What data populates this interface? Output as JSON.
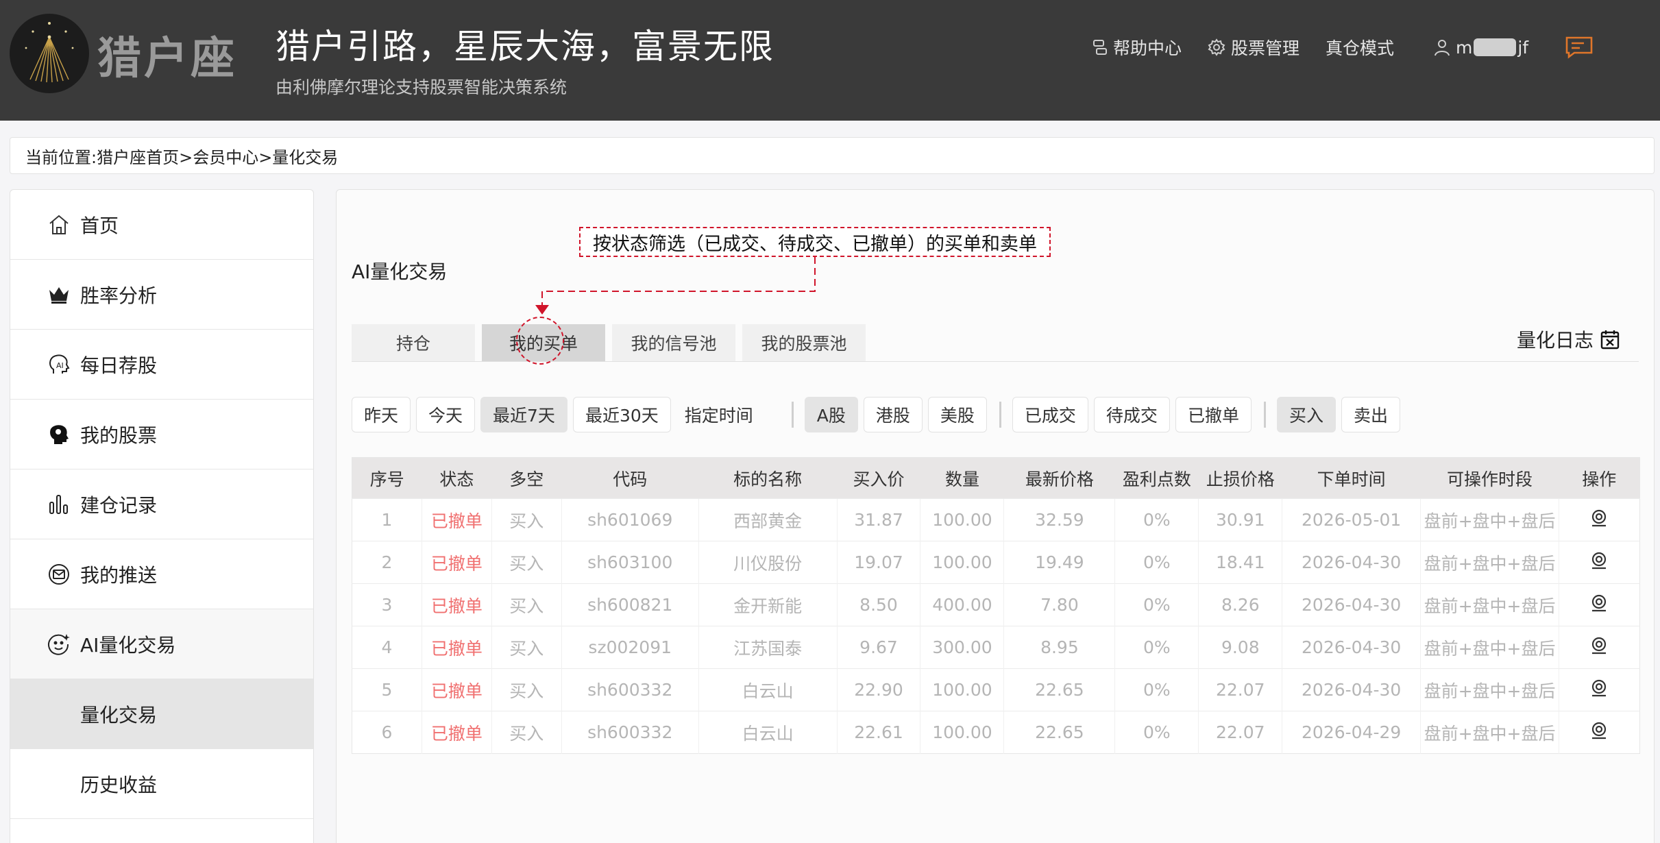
{
  "header": {
    "logo_text": "猎户座",
    "slogan": "猎户引路，星辰大海，富景无限",
    "subslogan": "由利佛摩尔理论支持股票智能决策系统",
    "nav": {
      "help": "帮助中心",
      "stock_mgmt": "股票管理",
      "real_mode": "真仓模式",
      "user_prefix": "m",
      "user_suffix": "jf"
    }
  },
  "breadcrumb": "当前位置:猎户座首页>会员中心>量化交易",
  "sidebar": {
    "items": [
      {
        "label": "首页",
        "icon": "home-icon"
      },
      {
        "label": "胜率分析",
        "icon": "crown-icon"
      },
      {
        "label": "每日荐股",
        "icon": "ai-head-icon"
      },
      {
        "label": "我的股票",
        "icon": "brain-head-icon"
      },
      {
        "label": "建仓记录",
        "icon": "bar-chart-icon"
      },
      {
        "label": "我的推送",
        "icon": "mail-icon"
      },
      {
        "label": "AI量化交易",
        "icon": "ai-face-icon"
      },
      {
        "label": "量化交易"
      },
      {
        "label": "历史收益"
      }
    ]
  },
  "main": {
    "annotation": "按状态筛选（已成交、待成交、已撤单）的买单和卖单",
    "title": "AI量化交易",
    "tabs": [
      {
        "label": "持仓"
      },
      {
        "label": "我的买单"
      },
      {
        "label": "我的信号池"
      },
      {
        "label": "我的股票池"
      }
    ],
    "quant_log": "量化日志",
    "filters": {
      "dates": [
        "昨天",
        "今天",
        "最近7天",
        "最近30天"
      ],
      "custom_date": "指定时间",
      "markets": [
        "A股",
        "港股",
        "美股"
      ],
      "statuses": [
        "已成交",
        "待成交",
        "已撤单"
      ],
      "directions": [
        "买入",
        "卖出"
      ]
    },
    "table": {
      "headers": [
        "序号",
        "状态",
        "多空",
        "代码",
        "标的名称",
        "买入价",
        "数量",
        "最新价格",
        "盈利点数",
        "止损价格",
        "下单时间",
        "可操作时段",
        "操作"
      ],
      "rows": [
        [
          "1",
          "已撤单",
          "买入",
          "sh601069",
          "西部黄金",
          "31.87",
          "100.00",
          "32.59",
          "0%",
          "30.91",
          "2026-05-01",
          "盘前+盘中+盘后"
        ],
        [
          "2",
          "已撤单",
          "买入",
          "sh603100",
          "川仪股份",
          "19.07",
          "100.00",
          "19.49",
          "0%",
          "18.41",
          "2026-04-30",
          "盘前+盘中+盘后"
        ],
        [
          "3",
          "已撤单",
          "买入",
          "sh600821",
          "金开新能",
          "8.50",
          "400.00",
          "7.80",
          "0%",
          "8.26",
          "2026-04-30",
          "盘前+盘中+盘后"
        ],
        [
          "4",
          "已撤单",
          "买入",
          "sz002091",
          "江苏国泰",
          "9.67",
          "300.00",
          "8.95",
          "0%",
          "9.08",
          "2026-04-30",
          "盘前+盘中+盘后"
        ],
        [
          "5",
          "已撤单",
          "买入",
          "sh600332",
          "白云山",
          "22.90",
          "100.00",
          "22.65",
          "0%",
          "22.07",
          "2026-04-30",
          "盘前+盘中+盘后"
        ],
        [
          "6",
          "已撤单",
          "买入",
          "sh600332",
          "白云山",
          "22.61",
          "100.00",
          "22.65",
          "0%",
          "22.07",
          "2026-04-29",
          "盘前+盘中+盘后"
        ]
      ]
    }
  },
  "colors": {
    "header_bg": "#3a3a3a",
    "status_cancelled": "#f07070",
    "annotation": "#d0142a",
    "message_icon": "#e0762a"
  }
}
